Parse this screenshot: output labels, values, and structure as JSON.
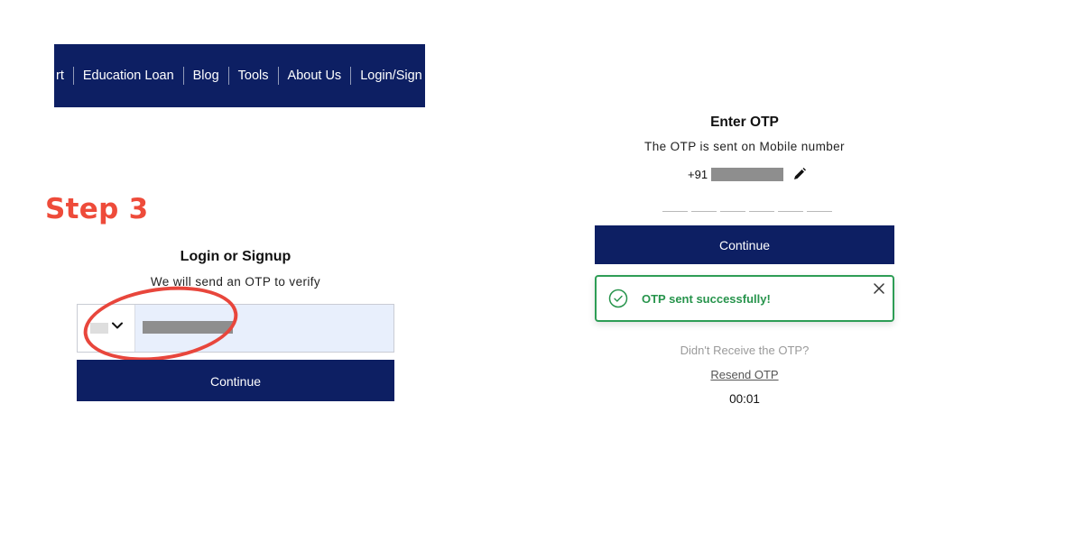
{
  "nav": {
    "items": [
      "rt",
      "Education Loan",
      "Blog",
      "Tools",
      "About Us",
      "Login/Sign u"
    ]
  },
  "step_label": "Step 3",
  "login": {
    "title": "Login or Signup",
    "subtitle": "We will send an OTP to verify",
    "continue_label": "Continue"
  },
  "otp": {
    "title": "Enter OTP",
    "subtitle": "The OTP is sent on Mobile number",
    "country_code": "+91",
    "continue_label": "Continue",
    "toast_message": "OTP sent successfully!",
    "didnt_receive": "Didn't Receive the OTP?",
    "resend_label": "Resend OTP",
    "timer": "00:01"
  },
  "colors": {
    "brand_navy": "#0d1f63",
    "step_red": "#ee4b3a",
    "success_green": "#2e9d56"
  },
  "icons": [
    "chevron-down-icon",
    "pencil-icon",
    "check-circle-icon",
    "close-icon"
  ]
}
